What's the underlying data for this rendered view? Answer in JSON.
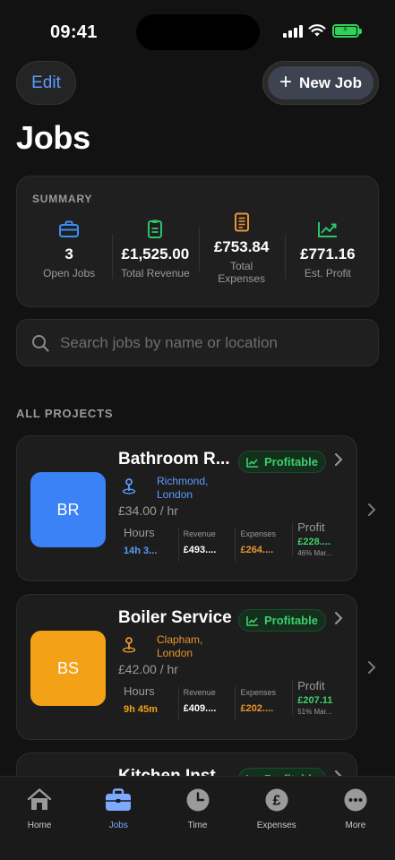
{
  "status_bar": {
    "time": "09:41"
  },
  "header": {
    "edit_label": "Edit",
    "new_job_label": "New Job",
    "title": "Jobs"
  },
  "summary": {
    "label": "SUMMARY",
    "stats": [
      {
        "icon": "briefcase-icon",
        "value": "3",
        "label": "Open Jobs",
        "color": "#3b8ff0"
      },
      {
        "icon": "receipt-icon",
        "value": "£1,525.00",
        "label": "Total Revenue",
        "color": "#2fc46a"
      },
      {
        "icon": "document-icon",
        "value": "£753.84",
        "label": "Total Expenses",
        "color": "#e8952f"
      },
      {
        "icon": "trend-up-icon",
        "value": "£771.16",
        "label": "Est. Profit",
        "color": "#2fc46a"
      }
    ]
  },
  "search": {
    "placeholder": "Search jobs by name or location"
  },
  "section_label": "ALL PROJECTS",
  "jobs": [
    {
      "initials": "BR",
      "avatar_color": "#3b82f6",
      "title": "Bathroom R...",
      "badge": "Profitable",
      "location": "Richmond, London",
      "location_color": "#5b9cff",
      "rate": "£34.00 / hr",
      "hours_label": "Hours",
      "hours": "14h 3...",
      "hours_color": "#5b9cff",
      "revenue_label": "Revenue",
      "revenue": "£493....",
      "expenses_label": "Expenses",
      "expenses": "£264....",
      "profit_label": "Profit",
      "profit": "£228....",
      "margin": "46% Mar..."
    },
    {
      "initials": "BS",
      "avatar_color": "#f3a116",
      "title": "Boiler Service",
      "badge": "Profitable",
      "location": "Clapham, London",
      "location_color": "#e8952f",
      "rate": "£42.00 / hr",
      "hours_label": "Hours",
      "hours": "9h 45m",
      "hours_color": "#f3a116",
      "revenue_label": "Revenue",
      "revenue": "£409....",
      "expenses_label": "Expenses",
      "expenses": "£202....",
      "profit_label": "Profit",
      "profit": "£207.11",
      "margin": "51% Mar..."
    },
    {
      "title": "Kitchen Inst...",
      "badge": "Profitable"
    }
  ],
  "tabs": [
    {
      "label": "Home",
      "icon": "home-icon"
    },
    {
      "label": "Jobs",
      "icon": "briefcase-icon"
    },
    {
      "label": "Time",
      "icon": "clock-icon"
    },
    {
      "label": "Expenses",
      "icon": "pound-icon"
    },
    {
      "label": "More",
      "icon": "more-icon"
    }
  ],
  "colors": {
    "expenses": "#e8952f",
    "profit": "#3ecf6c",
    "accent": "#5b9cff"
  }
}
